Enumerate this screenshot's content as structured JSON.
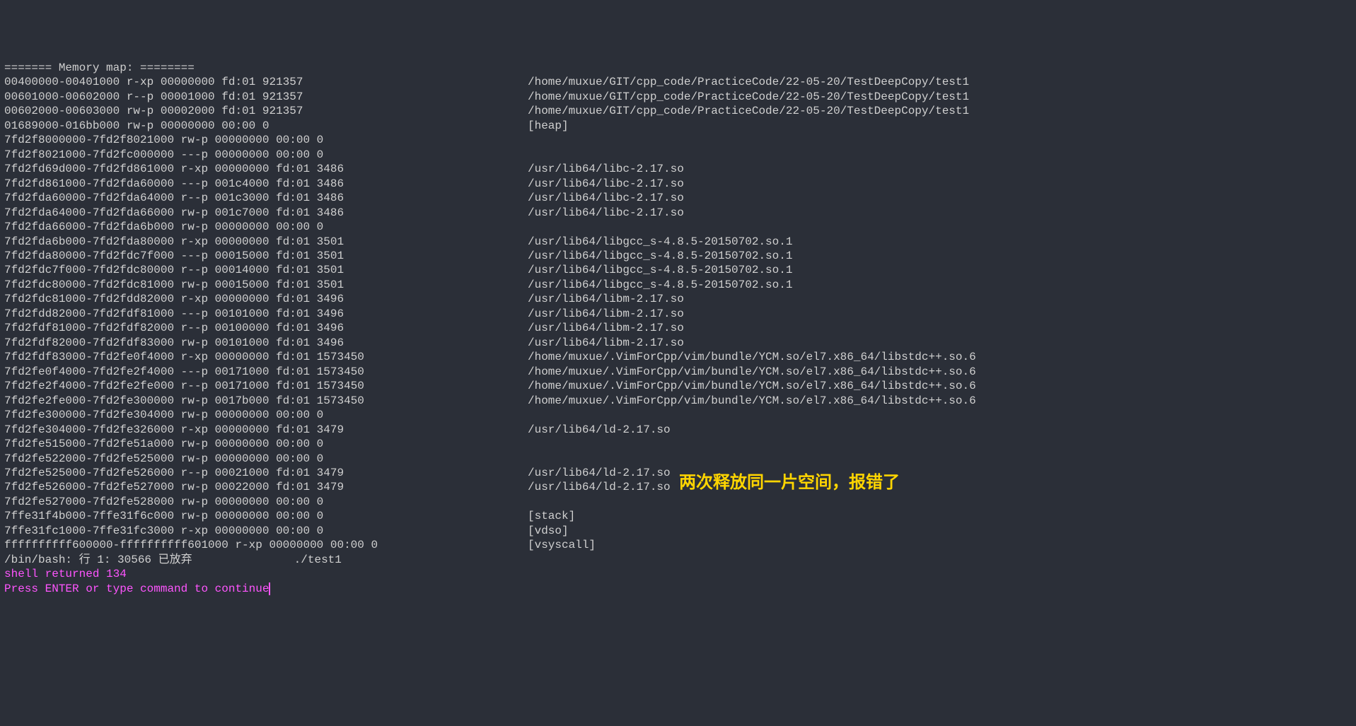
{
  "header": "======= Memory map: ========",
  "rows": [
    {
      "left": "00400000-00401000 r-xp 00000000 fd:01 921357",
      "right": "/home/muxue/GIT/cpp_code/PracticeCode/22-05-20/TestDeepCopy/test1"
    },
    {
      "left": "00601000-00602000 r--p 00001000 fd:01 921357",
      "right": "/home/muxue/GIT/cpp_code/PracticeCode/22-05-20/TestDeepCopy/test1"
    },
    {
      "left": "00602000-00603000 rw-p 00002000 fd:01 921357",
      "right": "/home/muxue/GIT/cpp_code/PracticeCode/22-05-20/TestDeepCopy/test1"
    },
    {
      "left": "01689000-016bb000 rw-p 00000000 00:00 0",
      "right": "[heap]"
    },
    {
      "left": "7fd2f8000000-7fd2f8021000 rw-p 00000000 00:00 0",
      "right": ""
    },
    {
      "left": "7fd2f8021000-7fd2fc000000 ---p 00000000 00:00 0",
      "right": ""
    },
    {
      "left": "7fd2fd69d000-7fd2fd861000 r-xp 00000000 fd:01 3486",
      "right": "/usr/lib64/libc-2.17.so"
    },
    {
      "left": "7fd2fd861000-7fd2fda60000 ---p 001c4000 fd:01 3486",
      "right": "/usr/lib64/libc-2.17.so"
    },
    {
      "left": "7fd2fda60000-7fd2fda64000 r--p 001c3000 fd:01 3486",
      "right": "/usr/lib64/libc-2.17.so"
    },
    {
      "left": "7fd2fda64000-7fd2fda66000 rw-p 001c7000 fd:01 3486",
      "right": "/usr/lib64/libc-2.17.so"
    },
    {
      "left": "7fd2fda66000-7fd2fda6b000 rw-p 00000000 00:00 0",
      "right": ""
    },
    {
      "left": "7fd2fda6b000-7fd2fda80000 r-xp 00000000 fd:01 3501",
      "right": "/usr/lib64/libgcc_s-4.8.5-20150702.so.1"
    },
    {
      "left": "7fd2fda80000-7fd2fdc7f000 ---p 00015000 fd:01 3501",
      "right": "/usr/lib64/libgcc_s-4.8.5-20150702.so.1"
    },
    {
      "left": "7fd2fdc7f000-7fd2fdc80000 r--p 00014000 fd:01 3501",
      "right": "/usr/lib64/libgcc_s-4.8.5-20150702.so.1"
    },
    {
      "left": "7fd2fdc80000-7fd2fdc81000 rw-p 00015000 fd:01 3501",
      "right": "/usr/lib64/libgcc_s-4.8.5-20150702.so.1"
    },
    {
      "left": "7fd2fdc81000-7fd2fdd82000 r-xp 00000000 fd:01 3496",
      "right": "/usr/lib64/libm-2.17.so"
    },
    {
      "left": "7fd2fdd82000-7fd2fdf81000 ---p 00101000 fd:01 3496",
      "right": "/usr/lib64/libm-2.17.so"
    },
    {
      "left": "7fd2fdf81000-7fd2fdf82000 r--p 00100000 fd:01 3496",
      "right": "/usr/lib64/libm-2.17.so"
    },
    {
      "left": "7fd2fdf82000-7fd2fdf83000 rw-p 00101000 fd:01 3496",
      "right": "/usr/lib64/libm-2.17.so"
    },
    {
      "left": "7fd2fdf83000-7fd2fe0f4000 r-xp 00000000 fd:01 1573450",
      "right": "/home/muxue/.VimForCpp/vim/bundle/YCM.so/el7.x86_64/libstdc++.so.6"
    },
    {
      "left": "7fd2fe0f4000-7fd2fe2f4000 ---p 00171000 fd:01 1573450",
      "right": "/home/muxue/.VimForCpp/vim/bundle/YCM.so/el7.x86_64/libstdc++.so.6"
    },
    {
      "left": "7fd2fe2f4000-7fd2fe2fe000 r--p 00171000 fd:01 1573450",
      "right": "/home/muxue/.VimForCpp/vim/bundle/YCM.so/el7.x86_64/libstdc++.so.6"
    },
    {
      "left": "7fd2fe2fe000-7fd2fe300000 rw-p 0017b000 fd:01 1573450",
      "right": "/home/muxue/.VimForCpp/vim/bundle/YCM.so/el7.x86_64/libstdc++.so.6"
    },
    {
      "left": "7fd2fe300000-7fd2fe304000 rw-p 00000000 00:00 0",
      "right": ""
    },
    {
      "left": "7fd2fe304000-7fd2fe326000 r-xp 00000000 fd:01 3479",
      "right": "/usr/lib64/ld-2.17.so"
    },
    {
      "left": "7fd2fe515000-7fd2fe51a000 rw-p 00000000 00:00 0",
      "right": ""
    },
    {
      "left": "7fd2fe522000-7fd2fe525000 rw-p 00000000 00:00 0",
      "right": ""
    },
    {
      "left": "7fd2fe525000-7fd2fe526000 r--p 00021000 fd:01 3479",
      "right": "/usr/lib64/ld-2.17.so"
    },
    {
      "left": "7fd2fe526000-7fd2fe527000 rw-p 00022000 fd:01 3479",
      "right": "/usr/lib64/ld-2.17.so"
    },
    {
      "left": "7fd2fe527000-7fd2fe528000 rw-p 00000000 00:00 0",
      "right": ""
    },
    {
      "left": "7ffe31f4b000-7ffe31f6c000 rw-p 00000000 00:00 0",
      "right": "[stack]"
    },
    {
      "left": "7ffe31fc1000-7ffe31fc3000 r-xp 00000000 00:00 0",
      "right": "[vdso]"
    },
    {
      "left": "ffffffffff600000-ffffffffff601000 r-xp 00000000 00:00 0",
      "right": "[vsyscall]"
    }
  ],
  "bash_line": "/bin/bash: 行 1: 30566 已放弃               ./test1",
  "blank": "",
  "shell_return": "shell returned 134",
  "prompt": "Press ENTER or type command to continue",
  "annotation": "两次释放同一片空间，报错了"
}
